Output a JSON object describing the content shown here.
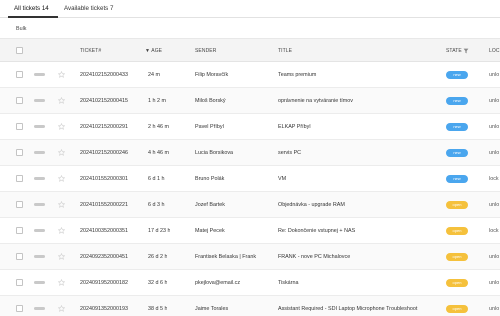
{
  "tabs": [
    {
      "label": "All tickets 14",
      "active": true
    },
    {
      "label": "Available tickets 7",
      "active": false
    }
  ],
  "bulk_label": "Bulk",
  "columns": {
    "ticket": "TICKET#",
    "age": "▼ AGE",
    "sender": "SENDER",
    "title": "TITLE",
    "state": "STATE",
    "lock": "LOC"
  },
  "rows": [
    {
      "ticket": "2024102152000433",
      "age": "24 m",
      "sender": "Filip Moravčík",
      "title": "Teams premium",
      "state": "new",
      "lock": "unlo"
    },
    {
      "ticket": "2024102152000415",
      "age": "1 h 2 m",
      "sender": "Miloš Borský",
      "title": "oprávnenie na vytváranie tímov",
      "state": "new",
      "lock": "unlo"
    },
    {
      "ticket": "2024102152000291",
      "age": "2 h 46 m",
      "sender": "Pavel Příbyl",
      "title": "ELKAP Příbyl",
      "state": "new",
      "lock": "unlo"
    },
    {
      "ticket": "2024102152000246",
      "age": "4 h 46 m",
      "sender": "Lucia Borsikova",
      "title": "servis PC",
      "state": "new",
      "lock": "unlo"
    },
    {
      "ticket": "2024101552000301",
      "age": "6 d 1 h",
      "sender": "Bruno Polák",
      "title": "VM",
      "state": "new",
      "lock": "lock"
    },
    {
      "ticket": "2024101552000221",
      "age": "6 d 3 h",
      "sender": "Jozef Bartek",
      "title": "Objednávka - upgrade RAM",
      "state": "open",
      "lock": "unlo"
    },
    {
      "ticket": "2024100352000351",
      "age": "17 d 23 h",
      "sender": "Matej Pecek",
      "title": "Re: Dokončenie vstupnej + NAS",
      "state": "open",
      "lock": "lock"
    },
    {
      "ticket": "2024092352000451",
      "age": "26 d 2 h",
      "sender": "Frantisek Belaska | Frank",
      "title": "FRANK - nove PC Michalovce",
      "state": "open",
      "lock": "unlo"
    },
    {
      "ticket": "2024091952000182",
      "age": "32 d 6 h",
      "sender": "pkejlova@email.cz",
      "title": "Tiskárna",
      "state": "open",
      "lock": "unlo"
    },
    {
      "ticket": "2024091352000193",
      "age": "38 d 5 h",
      "sender": "Jaime Torales",
      "title": "Assistant Required - SDI Laptop Microphone Troubleshoot",
      "state": "open",
      "lock": "unlo"
    }
  ],
  "colors": {
    "new": "#4aa6ee",
    "open": "#f5c13c"
  }
}
